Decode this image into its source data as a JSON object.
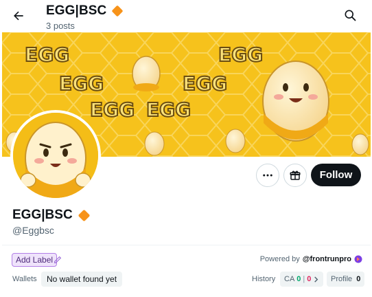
{
  "header": {
    "title": "EGG|BSC",
    "posts": "3 posts"
  },
  "banner": {
    "text_egg": "EGG"
  },
  "profile": {
    "name": "EGG|BSC",
    "handle": "@Eggbsc"
  },
  "actions": {
    "follow_label": "Follow"
  },
  "extension": {
    "add_label": "Add Label",
    "powered_by": "Powered by",
    "powered_link": "@frontrunpro",
    "wallets_label": "Wallets",
    "wallets_value": "No wallet found yet",
    "history_label": "History",
    "ca_label": "CA",
    "ca_green": "0",
    "ca_sep": "|",
    "ca_red": "0",
    "profile_label": "Profile",
    "profile_value": "0"
  },
  "colors": {
    "verified_badge": "#f7931a",
    "banner_bg": "#f6c21c",
    "follow_bg": "#0f1419",
    "label_border": "#b27ee6"
  },
  "icons": [
    "back-arrow-icon",
    "search-icon",
    "verified-badge-icon",
    "more-icon",
    "gift-icon",
    "pencil-icon",
    "frontrun-icon",
    "chevron-right-icon"
  ]
}
